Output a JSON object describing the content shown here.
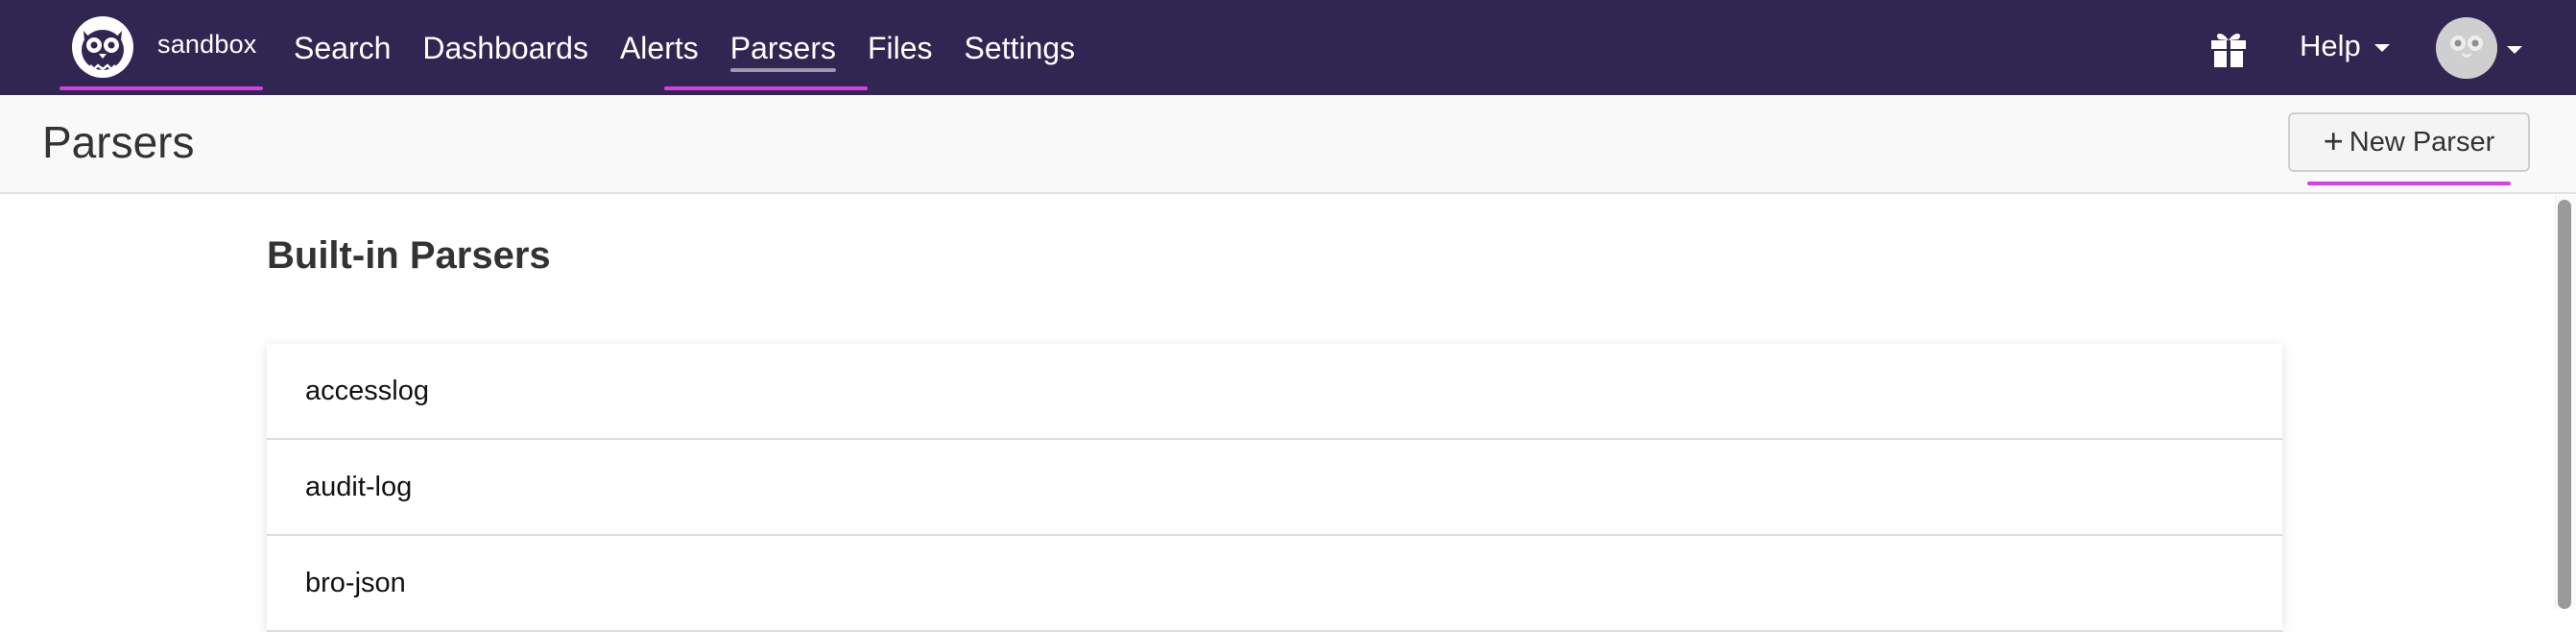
{
  "topnav": {
    "repo_name": "sandbox",
    "links": [
      {
        "label": "Search"
      },
      {
        "label": "Dashboards"
      },
      {
        "label": "Alerts"
      },
      {
        "label": "Parsers",
        "active": true
      },
      {
        "label": "Files"
      },
      {
        "label": "Settings"
      }
    ],
    "help_label": "Help",
    "icons": {
      "logo": "owl-logo-icon",
      "gift": "gift-icon",
      "avatar": "avatar-icon"
    }
  },
  "header": {
    "title": "Parsers",
    "new_button_label": "New Parser",
    "new_button_icon": "plus-icon"
  },
  "main": {
    "section_title": "Built-in Parsers",
    "parsers": [
      "accesslog",
      "audit-log",
      "bro-json"
    ]
  },
  "colors": {
    "nav_bg": "#312651",
    "accent_underline": "#d73ee6"
  }
}
